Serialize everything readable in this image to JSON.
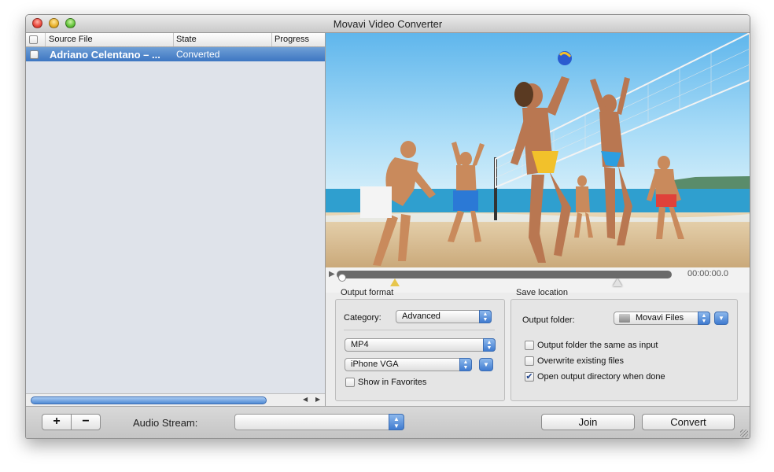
{
  "window": {
    "title": "Movavi Video Converter"
  },
  "file_list": {
    "columns": [
      "Source File",
      "State",
      "Progress"
    ],
    "rows": [
      {
        "name": "Adriano Celentano – ...",
        "state": "Converted",
        "progress": ""
      }
    ]
  },
  "player": {
    "timecode": "00:00:00.0",
    "position": 0.0
  },
  "output_format": {
    "section_label": "Output format",
    "category_label": "Category:",
    "category_value": "Advanced",
    "format_value": "MP4",
    "preset_value": "iPhone VGA",
    "favorites_label": "Show in Favorites",
    "favorites_checked": false
  },
  "save_location": {
    "section_label": "Save location",
    "folder_label": "Output folder:",
    "folder_value": "Movavi Files",
    "options": [
      {
        "label": "Output folder the same as input",
        "checked": false
      },
      {
        "label": "Overwrite existing files",
        "checked": false
      },
      {
        "label": "Open output directory when done",
        "checked": true
      }
    ]
  },
  "bottom": {
    "add_label": "+",
    "remove_label": "−",
    "audio_stream_label": "Audio Stream:",
    "audio_stream_value": "",
    "join_label": "Join",
    "convert_label": "Convert"
  },
  "colors": {
    "selection": "#3d76c2",
    "accent": "#3f7bd0"
  }
}
